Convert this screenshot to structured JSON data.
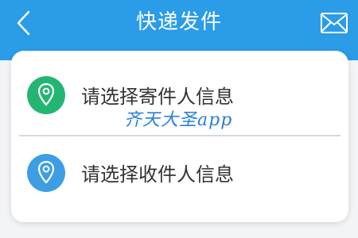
{
  "header": {
    "title": "快递发件",
    "back_icon": "back-chevron-icon",
    "mail_icon": "envelope-icon",
    "background_color": "#2a9ce8"
  },
  "rows": [
    {
      "label": "请选择寄件人信息",
      "icon": "location-pin-icon",
      "icon_color": "#25b573"
    },
    {
      "label": "请选择收件人信息",
      "icon": "location-pin-icon",
      "icon_color": "#3d9ee4"
    }
  ],
  "watermark": "齐天大圣app"
}
